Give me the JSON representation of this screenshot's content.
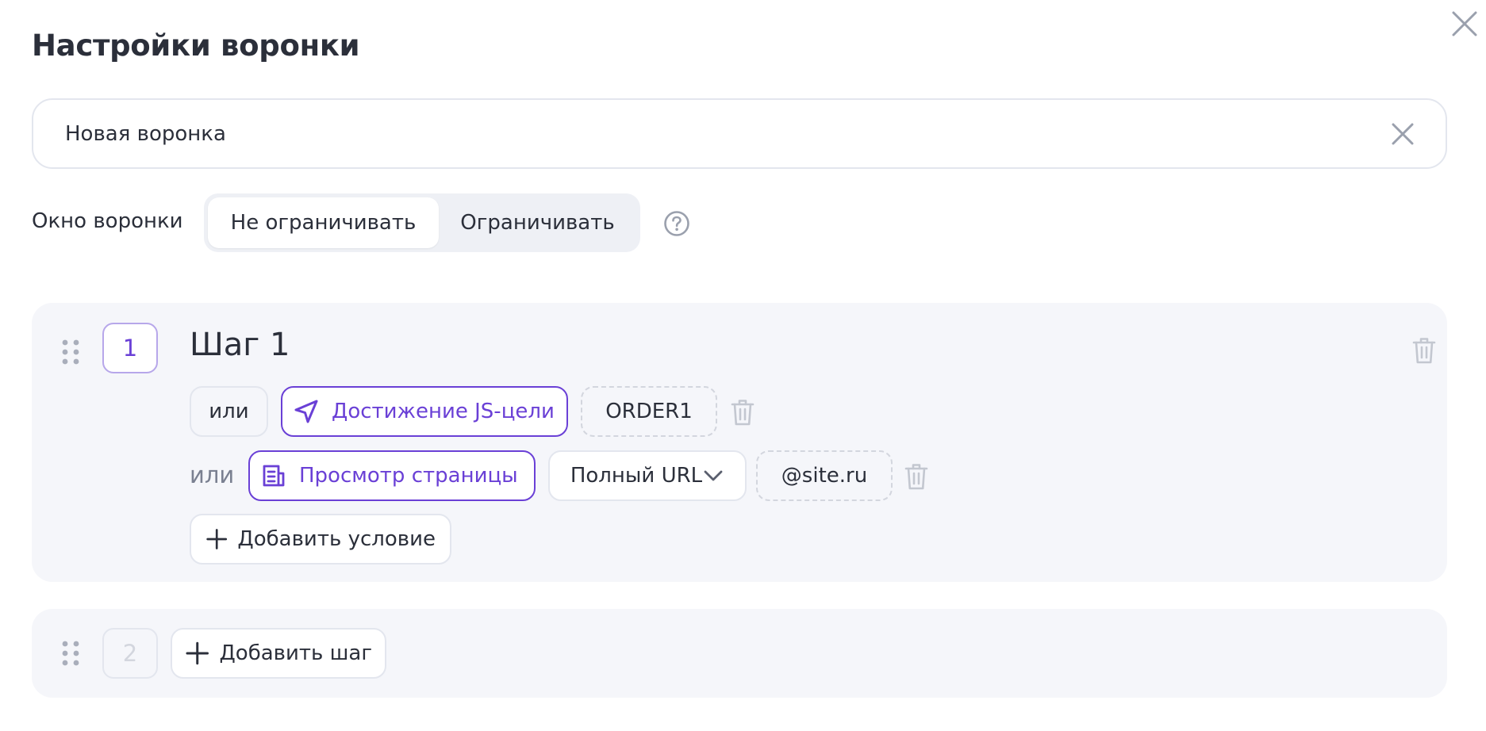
{
  "dialog": {
    "title": "Настройки воронки"
  },
  "funnel": {
    "name_value": "Новая воронка"
  },
  "window": {
    "label": "Окно воронки",
    "options": [
      "Не ограничивать",
      "Ограничивать"
    ],
    "selected": "Не ограничивать"
  },
  "steps": [
    {
      "number": "1",
      "title": "Шаг 1",
      "conditions": [
        {
          "connector": "или",
          "type_label": "Достижение JS-цели",
          "type_icon": "navigation-arrow-icon",
          "value": "ORDER1"
        },
        {
          "connector": "или",
          "type_label": "Просмотр страницы",
          "type_icon": "page-view-icon",
          "match_mode": "Полный URL",
          "value": "@site.ru"
        }
      ],
      "add_condition_label": "Добавить условие"
    },
    {
      "number": "2",
      "add_step_label": "Добавить шаг"
    }
  ],
  "colors": {
    "accent": "#6a40d6",
    "card_bg": "#f5f6fa",
    "border": "#e3e6ee",
    "muted_icon": "#c3c7d0"
  }
}
